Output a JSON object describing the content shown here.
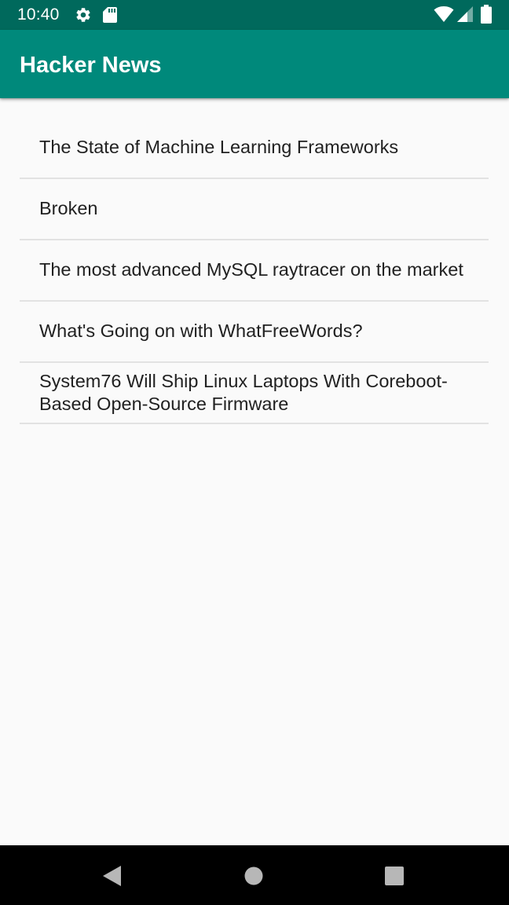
{
  "status_bar": {
    "time": "10:40",
    "icons": [
      "gear-icon",
      "sd-card-icon",
      "wifi-icon",
      "cell-signal-icon",
      "battery-icon"
    ]
  },
  "app_bar": {
    "title": "Hacker News",
    "color": "#00897b",
    "status_color": "#00695c"
  },
  "stories": [
    {
      "title": "The State of Machine Learning Frameworks"
    },
    {
      "title": "Broken"
    },
    {
      "title": "The most advanced MySQL raytracer on the market"
    },
    {
      "title": "What's Going on with WhatFreeWords?"
    },
    {
      "title": "System76 Will Ship Linux Laptops With Coreboot-Based Open-Source Firmware"
    }
  ],
  "nav_bar": {
    "buttons": [
      "back-icon",
      "home-icon",
      "recents-icon"
    ]
  }
}
